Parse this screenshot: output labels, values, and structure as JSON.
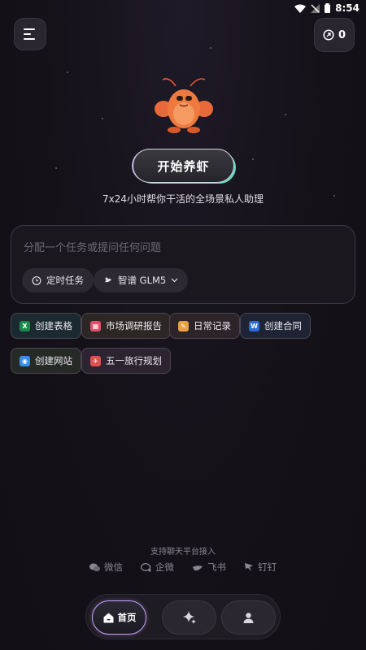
{
  "status_bar": {
    "time": "8:54"
  },
  "header": {
    "credits": "0"
  },
  "hero": {
    "start_button": "开始养虾",
    "subtitle": "7x24小时帮你干活的全场景私人助理"
  },
  "composer": {
    "placeholder": "分配一个任务或提问任何问题",
    "scheduled_task": "定时任务",
    "model_selector": "智谱 GLM5"
  },
  "quick_actions": [
    {
      "label": "创建表格",
      "icon": "spreadsheet-icon",
      "color": "#1d8a4c"
    },
    {
      "label": "市场调研报告",
      "icon": "report-icon",
      "color": "#e0506a"
    },
    {
      "label": "日常记录",
      "icon": "note-icon",
      "color": "#e8a040"
    },
    {
      "label": "创建合同",
      "icon": "word-doc-icon",
      "color": "#2b6cd8"
    },
    {
      "label": "创建网站",
      "icon": "website-icon",
      "color": "#3a8ee8"
    },
    {
      "label": "五一旅行规划",
      "icon": "travel-icon",
      "color": "#e05050"
    }
  ],
  "footer": {
    "support_text": "支持聊天平台接入",
    "platforms": [
      "微信",
      "企微",
      "飞书",
      "钉钉"
    ]
  },
  "nav": {
    "home_label": "首页"
  },
  "colors": {
    "accent_purple": "#c8a2ff",
    "accent_teal": "#5ce0c8",
    "background": "#141118"
  }
}
